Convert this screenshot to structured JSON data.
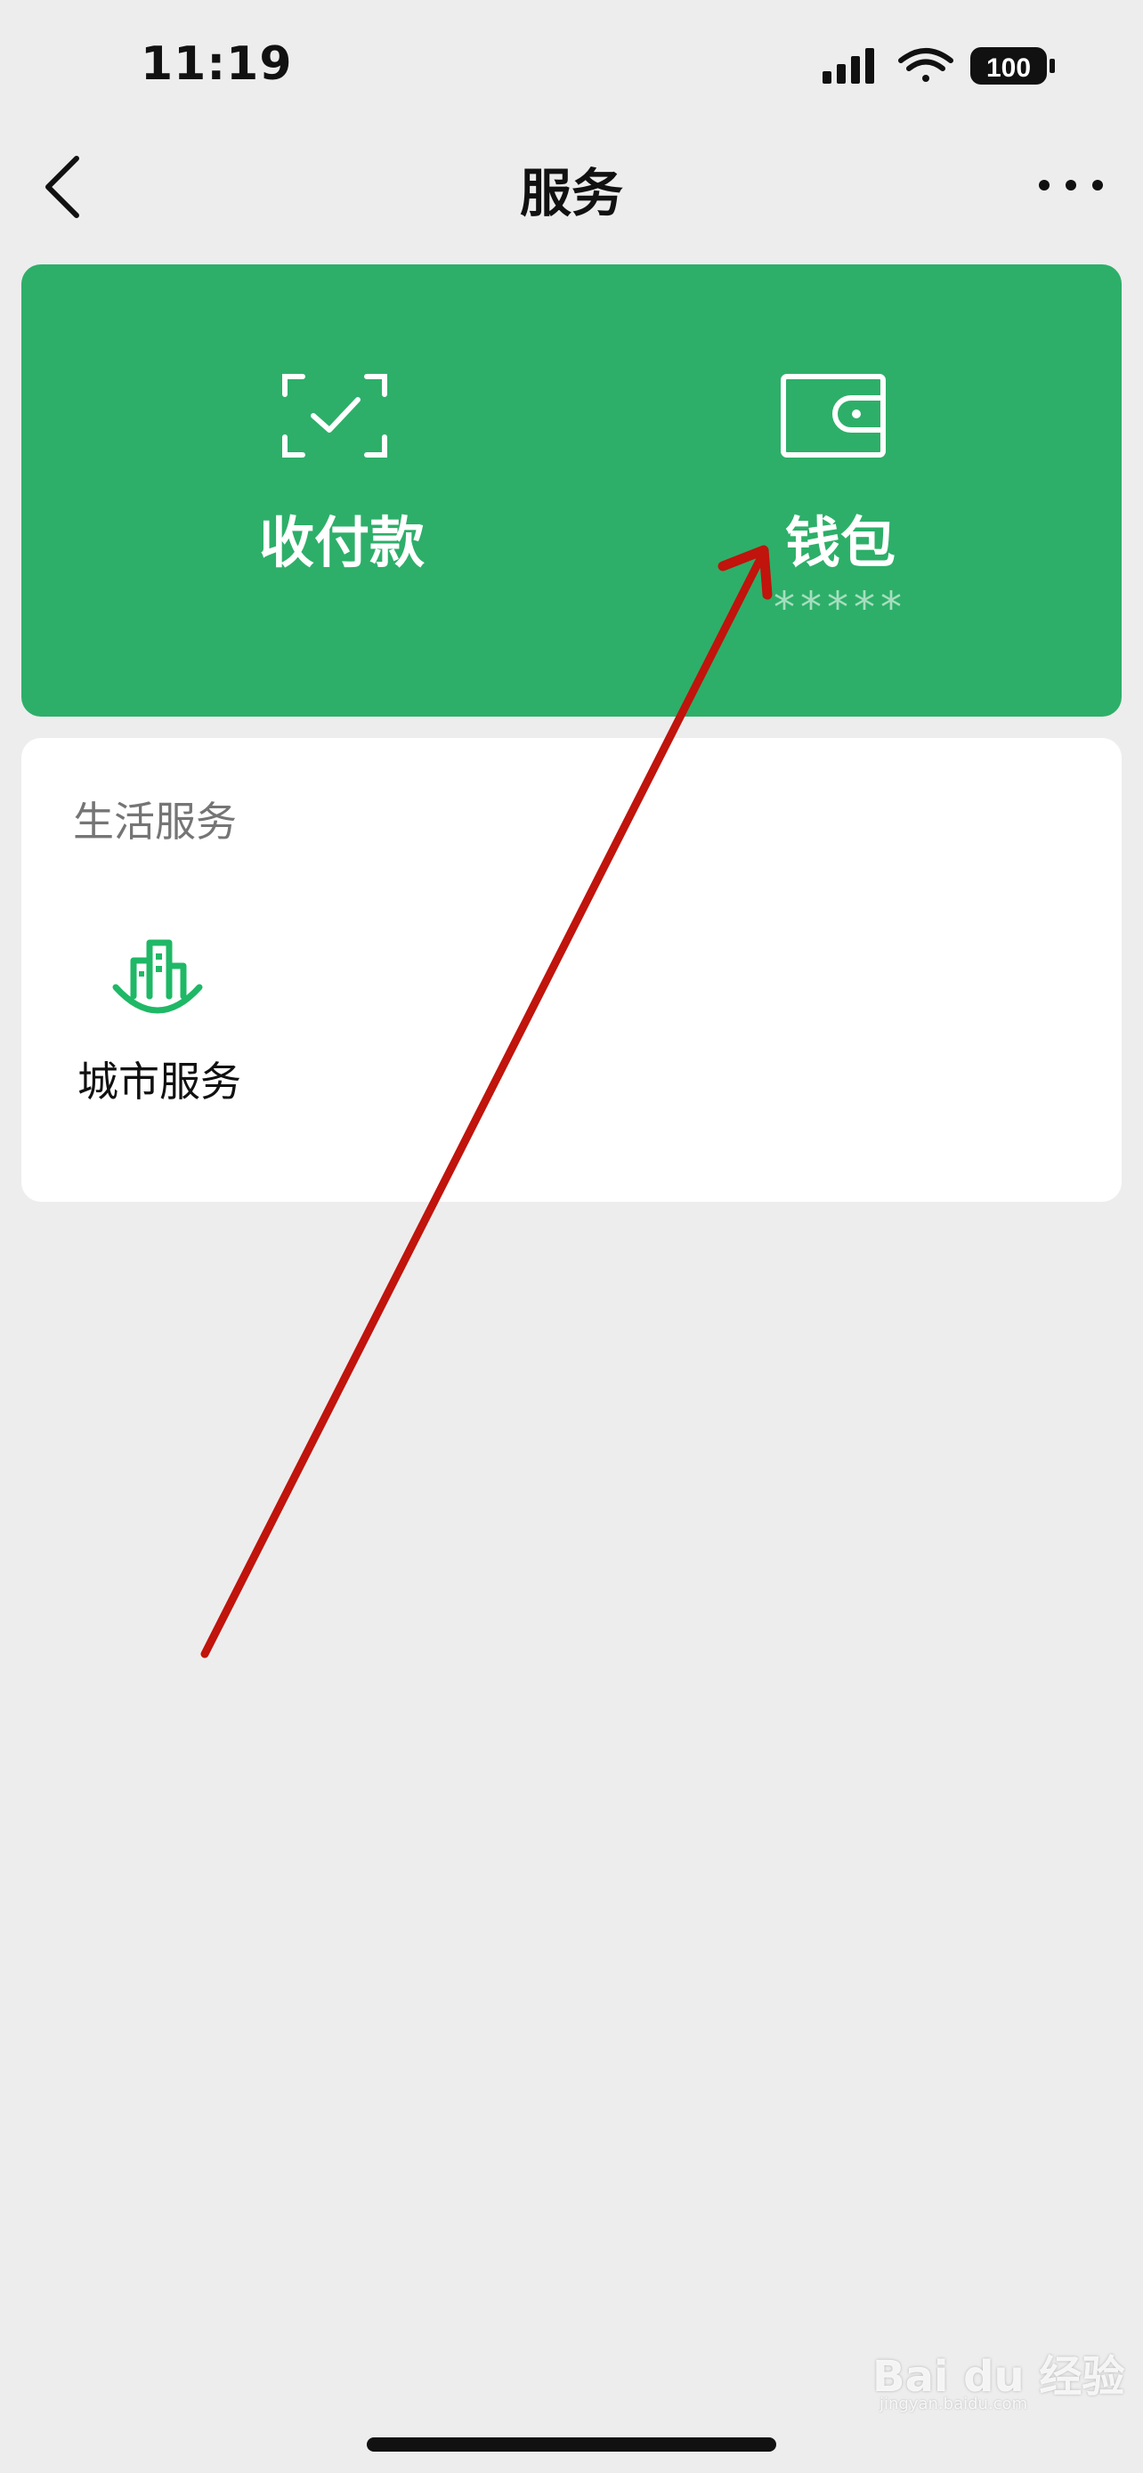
{
  "status_bar": {
    "time": "11:19",
    "battery": "100",
    "icons": [
      "signal-icon",
      "wifi-icon",
      "battery-icon"
    ]
  },
  "nav": {
    "title": "服务",
    "back_icon": "chevron-left-icon",
    "more_icon": "more-icon"
  },
  "top_services": [
    {
      "label": "收付款",
      "icon": "scan-check-icon"
    },
    {
      "label": "钱包",
      "sub": "*****",
      "icon": "wallet-icon"
    }
  ],
  "life_services": {
    "title": "生活服务",
    "items": [
      {
        "label": "城市服务",
        "icon": "city-buildings-icon"
      }
    ]
  },
  "watermark": {
    "text": "Bai du 经验",
    "sub": "jingyan.baidu.com"
  },
  "colors": {
    "background": "#ededed",
    "card_green": "#2daf69",
    "icon_green": "#1fb866",
    "annotation_red": "#c0140c"
  }
}
